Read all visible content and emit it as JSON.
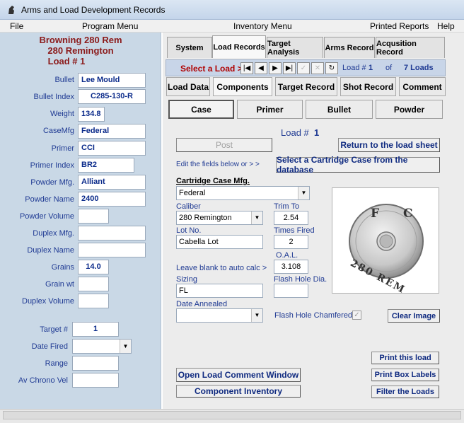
{
  "window": {
    "title": "Arms and Load Development Records"
  },
  "menu": {
    "file": "File",
    "program": "Program Menu",
    "inventory": "Inventory Menu",
    "printed": "Printed Reports",
    "help": "Help"
  },
  "load_header": {
    "rifle": "Browning 280 Rem",
    "cartridge": "280 Remington",
    "load_no": "Load #  1"
  },
  "left": {
    "bullet": {
      "label": "Bullet",
      "value": "Lee Mould"
    },
    "bullet_index": {
      "label": "Bullet Index",
      "value": "C285-130-R"
    },
    "weight": {
      "label": "Weight",
      "value": "134.8"
    },
    "case_mfg": {
      "label": "CaseMfg",
      "value": "Federal"
    },
    "primer": {
      "label": "Primer",
      "value": "CCI"
    },
    "primer_index": {
      "label": "Primer Index",
      "value": "BR2"
    },
    "powder_mfg": {
      "label": "Powder Mfg.",
      "value": "Alliant"
    },
    "powder_name": {
      "label": "Powder Name",
      "value": "2400"
    },
    "powder_volume": {
      "label": "Powder Volume",
      "value": ""
    },
    "duplex_mfg": {
      "label": "Duplex Mfg.",
      "value": ""
    },
    "duplex_name": {
      "label": "Duplex Name",
      "value": ""
    },
    "grains": {
      "label": "Grains",
      "value": "14.0"
    },
    "grain_wt": {
      "label": "Grain wt",
      "value": ""
    },
    "duplex_volume": {
      "label": "Duplex Volume",
      "value": ""
    },
    "target_no": {
      "label": "Target #",
      "value": "1"
    },
    "date_fired": {
      "label": "Date Fired",
      "value": ""
    },
    "range": {
      "label": "Range",
      "value": ""
    },
    "av_chrono": {
      "label": "Av Chrono Vel",
      "value": ""
    }
  },
  "tabs": [
    "System",
    "Load Records",
    "Target Analysis",
    "Arms Record",
    "Acqusition Record"
  ],
  "nav": {
    "select_label": "Select a Load >",
    "load_label": "Load #",
    "load_no": "1",
    "of": "of",
    "count": "7 Loads"
  },
  "subtabs": [
    "Load Data",
    "Components",
    "Target Record",
    "Shot Record",
    "Comment"
  ],
  "components": [
    "Case",
    "Primer",
    "Bullet",
    "Powder"
  ],
  "case_form": {
    "load_title": "Load #",
    "load_no": "1",
    "post": "Post",
    "return": "Return to the load sheet",
    "edit_hint": "Edit the fields below or > >",
    "select_db": "Select a Cartridge Case from the database",
    "mfg_label": "Cartridge Case Mfg.",
    "mfg_value": "Federal",
    "caliber_label": "Caliber",
    "caliber_value": "280 Remington",
    "trim_label": "Trim To",
    "trim_value": "2.54",
    "lot_label": "Lot No.",
    "lot_value": "Cabella Lot",
    "times_fired_label": "Times Fired",
    "times_fired_value": "2",
    "oal_label": "O.A.L.",
    "oal_value": "3.108",
    "blank_hint": "Leave blank to auto calc >",
    "sizing_label": "Sizing",
    "sizing_value": "FL",
    "flash_dia_label": "Flash Hole Dia.",
    "flash_dia_value": "",
    "annealed_label": "Date Annealed",
    "annealed_value": "",
    "chamfered_label": "Flash Hole Chamfered",
    "clear_image": "Clear Image",
    "headstamp_top": "F C",
    "headstamp_bottom": "280 REM"
  },
  "bottom_buttons": {
    "open_comment": "Open Load Comment Window",
    "component_inventory": "Component Inventory",
    "print_load": "Print this load",
    "print_box": "Print Box Labels",
    "filter": "Filter the Loads"
  }
}
